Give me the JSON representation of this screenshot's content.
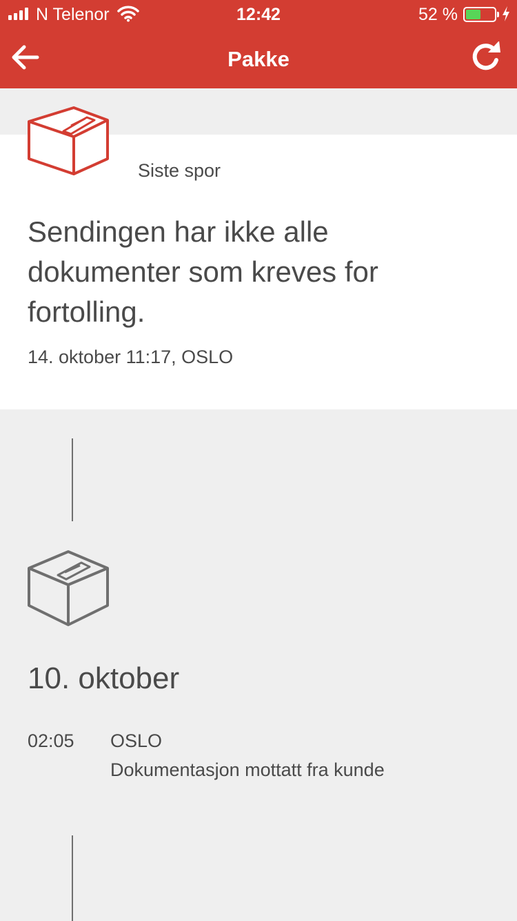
{
  "status_bar": {
    "carrier": "N Telenor",
    "time": "12:42",
    "battery_percent": "52 %",
    "battery_level": 0.52
  },
  "nav": {
    "title": "Pakke",
    "back_icon": "arrow-left-icon",
    "refresh_icon": "refresh-icon"
  },
  "latest": {
    "label": "Siste spor",
    "message": "Sendingen har ikke alle dokumenter som kreves for fortolling.",
    "meta": "14. oktober 11:17, OSLO"
  },
  "history": [
    {
      "date": "10. oktober",
      "events": [
        {
          "time": "02:05",
          "location": "OSLO",
          "description": "Dokumentasjon mottatt fra kunde"
        }
      ]
    }
  ],
  "colors": {
    "brand": "#d33d32",
    "background": "#efefef",
    "card": "#ffffff",
    "text": "#4a4a4a",
    "battery_fill": "#58d558"
  }
}
